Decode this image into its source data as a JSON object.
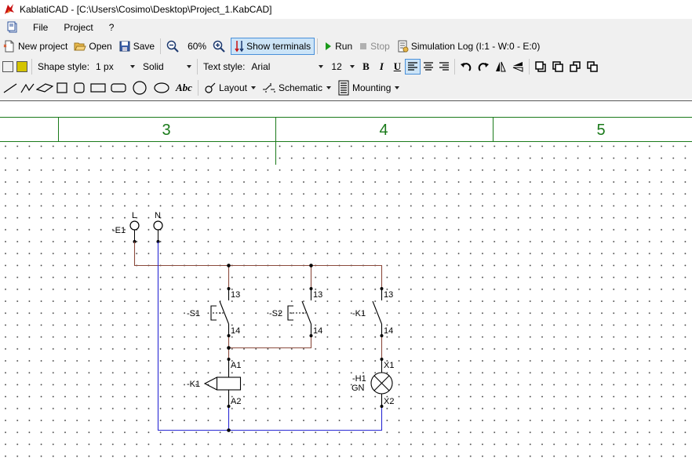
{
  "window": {
    "title": "KablatiCAD - [C:\\Users\\Cosimo\\Desktop\\Project_1.KabCAD]"
  },
  "menu": {
    "items": [
      "File",
      "Project",
      "?"
    ]
  },
  "toolbar1": {
    "new_project": "New project",
    "open": "Open",
    "save": "Save",
    "zoom": "60%",
    "show_terminals": "Show terminals",
    "run": "Run",
    "stop": "Stop",
    "simulation_log": "Simulation Log (I:1 - W:0 - E:0)"
  },
  "toolbar2": {
    "stroke_color": "#000000",
    "fill_color": "#d4c400",
    "shape_style_label": "Shape style:",
    "line_width": "1 px",
    "line_style": "Solid",
    "text_style_label": "Text style:",
    "font": "Arial",
    "font_size": "12",
    "bold": "B",
    "italic": "I",
    "underline": "U"
  },
  "toolbar3": {
    "text_tool": "Abc",
    "layout": "Layout",
    "schematic": "Schematic",
    "mounting": "Mounting"
  },
  "sheet": {
    "frame_color": "#1a7a1a",
    "columns": [
      "3",
      "4",
      "5"
    ]
  },
  "schematic": {
    "wire_colors": {
      "phase": "#8b4a3c",
      "neutral": "#2a2ad4"
    },
    "supply": {
      "tag": "-E1",
      "terminals": [
        "L",
        "N"
      ]
    },
    "switches": [
      {
        "tag": "-S1",
        "pins": [
          "13",
          "14"
        ]
      },
      {
        "tag": "-S2",
        "pins": [
          "13",
          "14"
        ]
      },
      {
        "tag": "-K1",
        "pins": [
          "13",
          "14"
        ]
      }
    ],
    "coil": {
      "tag": "-K1",
      "pins": [
        "A1",
        "A2"
      ]
    },
    "lamp": {
      "tag": "-H1",
      "color_code": "GN",
      "pins": [
        "X1",
        "X2"
      ]
    }
  }
}
